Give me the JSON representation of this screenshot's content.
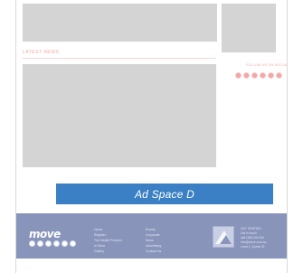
{
  "sections": {
    "latest_news": "LATEST NEWS",
    "follow_label": "FOLLOW US ON SOCIAL"
  },
  "ad": {
    "label": "Ad Space D",
    "color": "#3b80c4"
  },
  "footer": {
    "logo": "move",
    "background": "#8994bb",
    "columns": [
      [
        "Home",
        "Register",
        "The Health Precinct",
        "In Store",
        "Gallery"
      ],
      [
        "Events",
        "Corporate",
        "News",
        "Advertising",
        "Contact Us"
      ]
    ],
    "contact": [
      "GET STARTED",
      "Get in touch",
      "call 1300 000 000",
      "info@move.com.au",
      "Level 1, Queen St"
    ]
  },
  "social_icons": [
    "facebook-icon",
    "twitter-icon",
    "instagram-icon",
    "youtube-icon",
    "linkedin-icon",
    "email-icon"
  ],
  "colors": {
    "accent_pink": "#f0a8a6",
    "placeholder_gray": "#d4d4d4"
  }
}
